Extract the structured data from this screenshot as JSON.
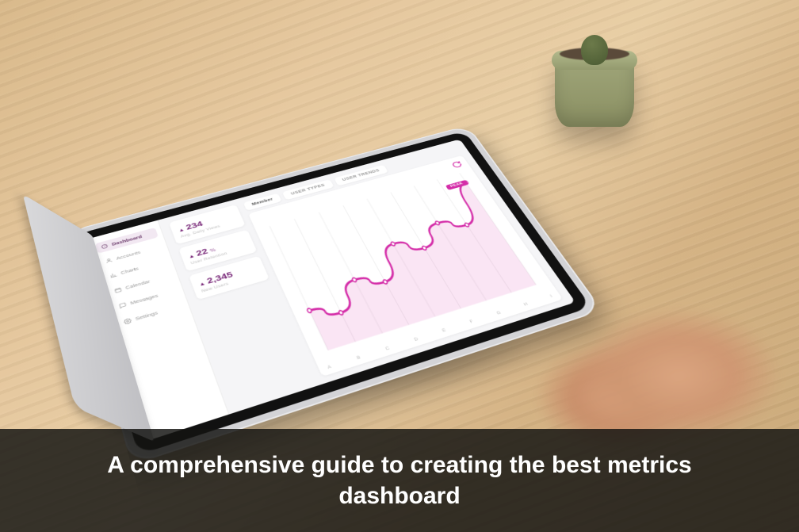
{
  "caption": "A comprehensive guide to creating the best metrics dashboard",
  "sidebar": {
    "items": [
      {
        "label": "Dashboard",
        "icon": "gauge-icon",
        "active": true
      },
      {
        "label": "Accounts",
        "icon": "user-icon",
        "active": false
      },
      {
        "label": "Charts",
        "icon": "chart-icon",
        "active": false
      },
      {
        "label": "Calendar",
        "icon": "calendar-icon",
        "active": false
      },
      {
        "label": "Messages",
        "icon": "message-icon",
        "active": false
      },
      {
        "label": "Settings",
        "icon": "gear-icon",
        "active": false
      }
    ]
  },
  "stats": [
    {
      "arrow": "▲",
      "value": "234",
      "unit": "",
      "label": "Avg. Daily Views"
    },
    {
      "arrow": "▲",
      "value": "22",
      "unit": "%",
      "label": "User Retention"
    },
    {
      "arrow": "▲",
      "value": "2,345",
      "unit": "",
      "label": "New Users"
    }
  ],
  "tabs": [
    {
      "label": "Member",
      "kind": "member"
    },
    {
      "label": "USER TYPES",
      "kind": "normal"
    },
    {
      "label": "USER TRENDS",
      "kind": "normal"
    }
  ],
  "chart_data": {
    "type": "line",
    "categories": [
      "A",
      "B",
      "C",
      "D",
      "E",
      "F",
      "G",
      "H",
      "I"
    ],
    "values": [
      30,
      22,
      42,
      34,
      60,
      50,
      66,
      58,
      92
    ],
    "ylim": [
      0,
      100
    ],
    "peak_label": "PEAK",
    "peak_index": 8,
    "title": "",
    "xlabel": "",
    "ylabel": ""
  },
  "colors": {
    "accent": "#d42ca8",
    "accent_light": "#f2c9e8"
  }
}
